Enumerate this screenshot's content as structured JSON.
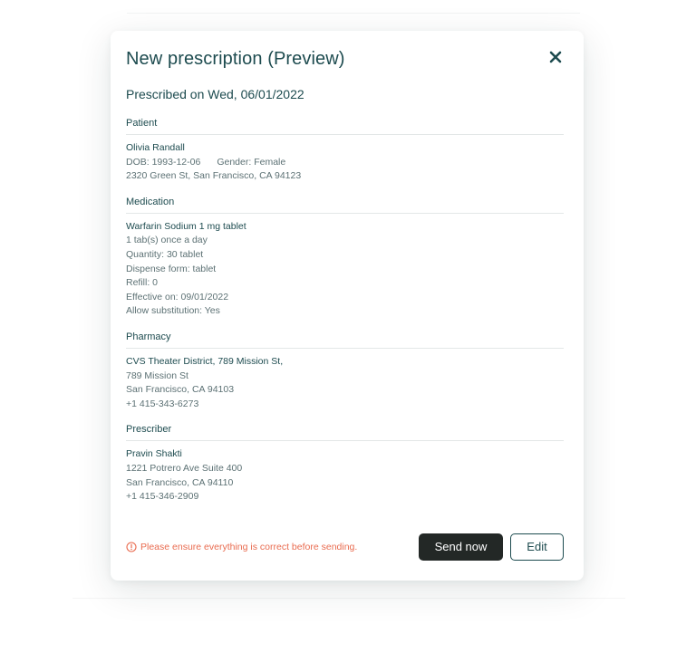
{
  "modal": {
    "title": "New prescription (Preview)",
    "prescribed_on": "Prescribed on Wed, 06/01/2022"
  },
  "patient": {
    "heading": "Patient",
    "name": "Olivia Randall",
    "dob_label": "DOB:",
    "dob": "1993-12-06",
    "gender_label": "Gender:",
    "gender": "Female",
    "address": "2320 Green St, San Francisco, CA 94123"
  },
  "medication": {
    "heading": "Medication",
    "name": "Warfarin Sodium 1 mg tablet",
    "directions": "1 tab(s) once a day",
    "quantity": "Quantity:  30 tablet",
    "dispense_form": "Dispense form:  tablet",
    "refill": "Refill:  0",
    "effective_on": "Effective on:  09/01/2022",
    "allow_substitution": "Allow substitution:  Yes"
  },
  "pharmacy": {
    "heading": "Pharmacy",
    "name": "CVS Theater District, 789 Mission St,",
    "street": "789 Mission St",
    "city": "San Francisco, CA 94103",
    "phone": "+1 415-343-6273"
  },
  "prescriber": {
    "heading": "Prescriber",
    "name": "Pravin Shakti",
    "street": "1221 Potrero Ave Suite 400",
    "city": "San Francisco, CA 94110",
    "phone": "+1 415-346-2909"
  },
  "footer": {
    "warning": "Please ensure everything is correct before sending.",
    "send_label": "Send now",
    "edit_label": "Edit"
  },
  "icons": {
    "close": "close-icon",
    "warning": "info-circle-icon"
  },
  "colors": {
    "primary_text": "#1d4b4f",
    "secondary_text": "#5c7174",
    "warning": "#e96b4f",
    "primary_button": "#232826"
  }
}
